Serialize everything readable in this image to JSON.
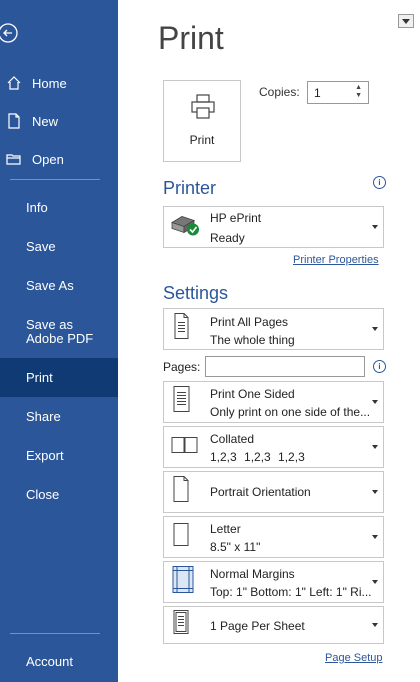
{
  "sidebar": {
    "nav_top": [
      {
        "label": "Home",
        "icon": "home-icon"
      },
      {
        "label": "New",
        "icon": "new-document-icon"
      },
      {
        "label": "Open",
        "icon": "folder-icon"
      }
    ],
    "nav_mid": [
      {
        "label": "Info"
      },
      {
        "label": "Save"
      },
      {
        "label": "Save As"
      },
      {
        "label": "Save as Adobe PDF"
      },
      {
        "label": "Print"
      },
      {
        "label": "Share"
      },
      {
        "label": "Export"
      },
      {
        "label": "Close"
      }
    ],
    "account": "Account",
    "colors": {
      "bg": "#2b579a",
      "selected": "#0f3a73"
    }
  },
  "main": {
    "title": "Print",
    "print_button": "Print",
    "copies_label": "Copies:",
    "copies_value": "1",
    "printer_heading": "Printer",
    "printer": {
      "name": "HP ePrint",
      "status": "Ready"
    },
    "printer_properties": "Printer Properties",
    "settings_heading": "Settings",
    "pages_label": "Pages:",
    "pages_value": "",
    "settings": [
      {
        "line1": "Print All Pages",
        "line2": "The whole thing",
        "icon": "pages-icon"
      },
      {
        "line1": "Print One Sided",
        "line2": "Only print on one side of the...",
        "icon": "one-sided-icon"
      },
      {
        "line1": "Collated",
        "line2": "1,2,3    1,2,3    1,2,3",
        "icon": "collated-icon"
      },
      {
        "line1": "Portrait Orientation",
        "line2": "",
        "icon": "portrait-icon"
      },
      {
        "line1": "Letter",
        "line2": "8.5\" x 11\"",
        "icon": "paper-size-icon"
      },
      {
        "line1": "Normal Margins",
        "line2": "Top: 1\" Bottom: 1\" Left: 1\" Ri...",
        "icon": "margins-icon"
      },
      {
        "line1": "1 Page Per Sheet",
        "line2": "",
        "icon": "pages-per-sheet-icon"
      }
    ],
    "page_setup": "Page Setup",
    "accent": "#2b579a"
  }
}
